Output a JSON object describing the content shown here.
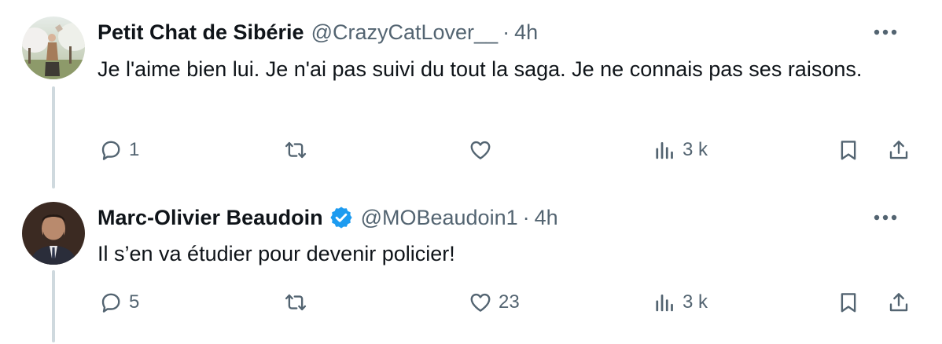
{
  "tweets": [
    {
      "display_name": "Petit Chat de Sibérie",
      "handle": "@CrazyCatLover__",
      "separator": "·",
      "time": "4h",
      "verified": false,
      "text": "Je l'aime bien lui. Je n'ai pas suivi du tout la saga. Je ne connais pas ses raisons.",
      "replies": "1",
      "retweets": "",
      "likes": "",
      "views": "3 k",
      "avatar_icon": "avatar-photo-cat",
      "more_icon": "more-icon"
    },
    {
      "display_name": "Marc-Olivier Beaudoin",
      "handle": "@MOBeaudoin1",
      "separator": "·",
      "time": "4h",
      "verified": true,
      "text": "Il s’en va étudier pour devenir policier!",
      "replies": "5",
      "retweets": "",
      "likes": "23",
      "views": "3 k",
      "avatar_icon": "avatar-photo-man",
      "more_icon": "more-icon"
    }
  ],
  "colors": {
    "text_primary": "#0f1419",
    "text_secondary": "#536471",
    "thread_line": "#cfd9de",
    "verified_blue": "#1d9bf0"
  }
}
